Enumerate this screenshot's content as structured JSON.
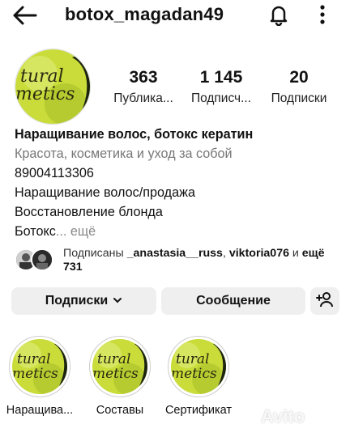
{
  "header": {
    "username": "botox_magadan49",
    "icons": [
      "back-arrow-icon",
      "bell-icon",
      "more-vertical-icon"
    ]
  },
  "avatar": {
    "text_top": "tural",
    "text_bottom": "metics",
    "bg_color": "#c9dc3a"
  },
  "stats": [
    {
      "value": "363",
      "label": "Публика..."
    },
    {
      "value": "1 145",
      "label": "Подписч..."
    },
    {
      "value": "20",
      "label": "Подписки"
    }
  ],
  "bio": {
    "name": "Наращивание волос, ботокс кератин",
    "category": "Красота, косметика и уход за собой",
    "lines": [
      "89004113306",
      "Наращивание волос/продажа",
      "Восстановление блонда"
    ],
    "last_line": "Ботокс",
    "more": "... ещё"
  },
  "followed_by": {
    "prefix": "Подписаны ",
    "user1": "_anastasia__russ",
    "sep": ", ",
    "user2": "viktoria076",
    "mid": " и ",
    "more": "ещё 731"
  },
  "buttons": {
    "subscriptions": "Подписки",
    "message": "Сообщение",
    "add_person_icon": "add-person-icon"
  },
  "highlights": [
    {
      "label": "Наращива...",
      "text_top": "tural",
      "text_bottom": "metics"
    },
    {
      "label": "Составы",
      "text_top": "tural",
      "text_bottom": "metics"
    },
    {
      "label": "Сертификат",
      "text_top": "tural",
      "text_bottom": "metics"
    }
  ],
  "watermark": "Avito"
}
